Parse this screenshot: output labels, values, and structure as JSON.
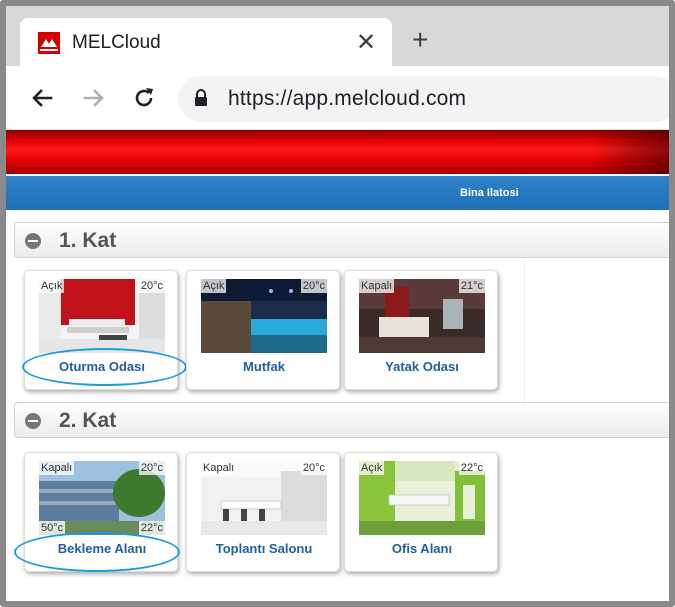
{
  "browser": {
    "tab_title": "MELCloud",
    "url": "https://app.melcloud.com"
  },
  "header": {
    "building_link": "Bina Ilatosi"
  },
  "floors": [
    {
      "title": "1. Kat",
      "rooms": [
        {
          "name": "Oturma Odası",
          "status": "Açık",
          "temp": "20°c"
        },
        {
          "name": "Mutfak",
          "status": "Açık",
          "temp": "20°c"
        },
        {
          "name": "Yatak Odası",
          "status": "Kapalı",
          "temp": "21°c"
        }
      ]
    },
    {
      "title": "2. Kat",
      "rooms": [
        {
          "name": "Bekleme Alanı",
          "status": "Kapalı",
          "temp": "20°c",
          "outdoor": "50°c",
          "set_temp": "22°c"
        },
        {
          "name": "Toplantı Salonu",
          "status": "Kapalı",
          "temp": "20°c"
        },
        {
          "name": "Ofis Alanı",
          "status": "Açık",
          "temp": "22°c"
        }
      ]
    }
  ],
  "colors": {
    "accent_red": "#e00000",
    "nav_blue": "#2f83c8",
    "link_blue": "#1f5fa5",
    "highlight": "#1e9be0"
  }
}
